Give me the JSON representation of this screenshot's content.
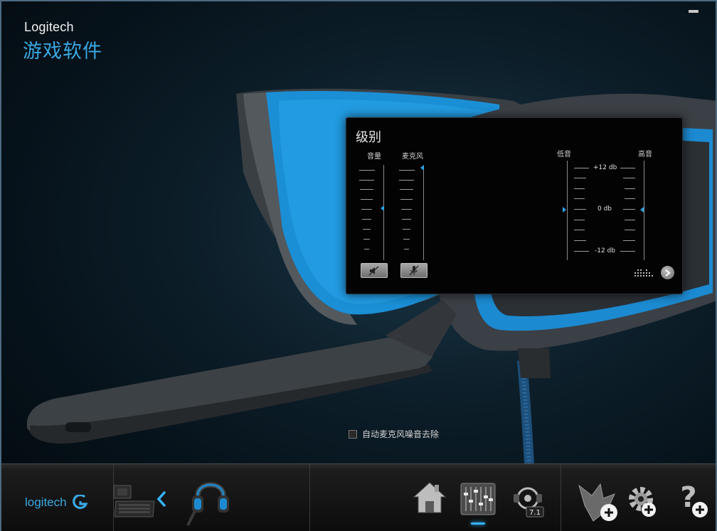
{
  "window": {
    "brand": "Logitech",
    "title": "游戏软件"
  },
  "levels_panel": {
    "title": "级别",
    "volume_label": "音量",
    "mic_label": "麦克风",
    "bass_label": "低音",
    "treble_label": "高音",
    "db_top": "+12 db",
    "db_mid": "0 db",
    "db_bottom": "-12 db",
    "volume_level": 0.5,
    "mic_level": 1.0,
    "bass_level": 0.5,
    "treble_level": 0.5
  },
  "noise_cancel": {
    "label": "自动麦克风噪音去除",
    "checked": false
  },
  "bottom_bar": {
    "logo_text": "logitech",
    "icons": [
      "home-icon",
      "equalizer-icon",
      "surround-7-1-icon",
      "gaming-mode-icon",
      "settings-icon",
      "help-icon"
    ],
    "accent": "#35b3ff"
  },
  "colors": {
    "accent_blue": "#2ea2e6",
    "title_blue": "#3aa8e2"
  }
}
